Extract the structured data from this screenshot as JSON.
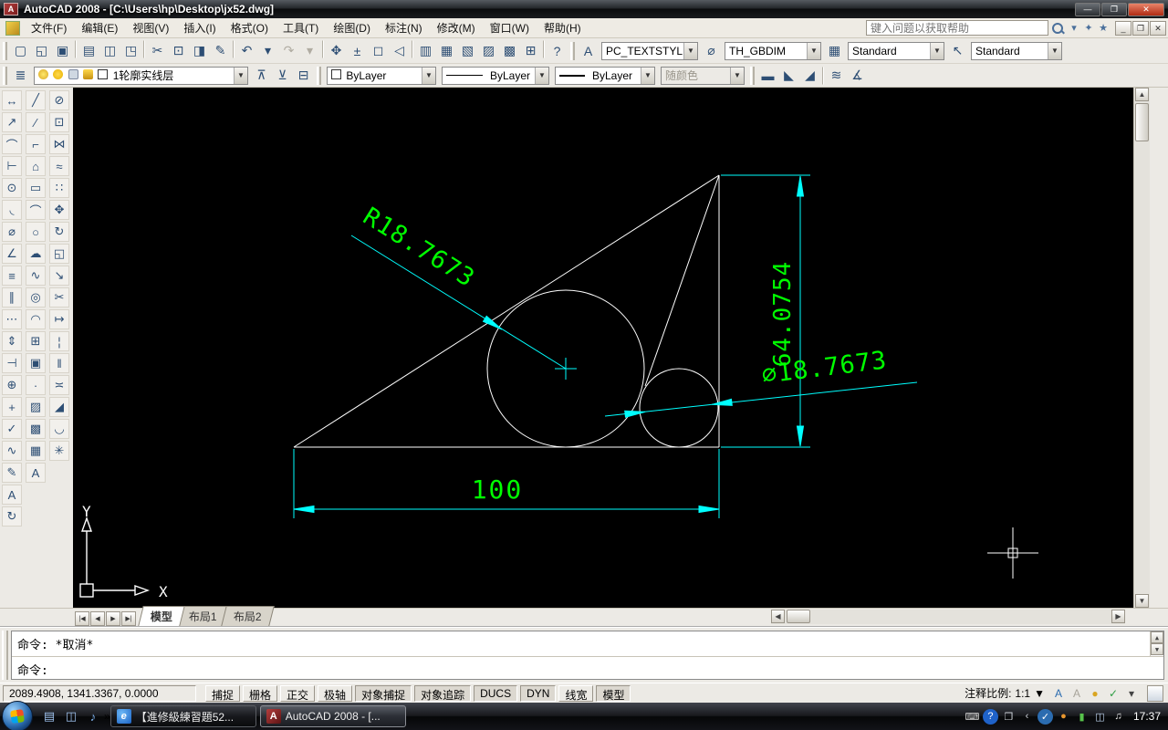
{
  "window": {
    "title": "AutoCAD 2008 - [C:\\Users\\hp\\Desktop\\jx52.dwg]",
    "controls": {
      "minimize": "—",
      "restore": "❐",
      "close": "✕"
    },
    "doc_controls": {
      "minimize": "_",
      "restore": "❐",
      "close": "✕"
    }
  },
  "menu": {
    "items": [
      "文件(F)",
      "编辑(E)",
      "视图(V)",
      "插入(I)",
      "格式(O)",
      "工具(T)",
      "绘图(D)",
      "标注(N)",
      "修改(M)",
      "窗口(W)",
      "帮助(H)"
    ],
    "help_placeholder": "键入问题以获取帮助"
  },
  "toolbars": {
    "standard": [
      {
        "name": "new-file",
        "glyph": "▢"
      },
      {
        "name": "open-file",
        "glyph": "◱"
      },
      {
        "name": "save-file",
        "glyph": "▣"
      },
      {
        "name": "separator",
        "sep": true
      },
      {
        "name": "plot",
        "glyph": "▤"
      },
      {
        "name": "plot-preview",
        "glyph": "◫"
      },
      {
        "name": "publish",
        "glyph": "◳"
      },
      {
        "name": "separator",
        "sep": true
      },
      {
        "name": "cut",
        "glyph": "✂"
      },
      {
        "name": "copy-clip",
        "glyph": "⊡"
      },
      {
        "name": "paste",
        "glyph": "◨"
      },
      {
        "name": "match-properties",
        "glyph": "✎"
      },
      {
        "name": "separator",
        "sep": true
      },
      {
        "name": "undo",
        "glyph": "↶"
      },
      {
        "name": "undo-dropdown",
        "glyph": "▾"
      },
      {
        "name": "redo",
        "glyph": "↷",
        "disabled": true
      },
      {
        "name": "redo-dropdown",
        "glyph": "▾",
        "disabled": true
      },
      {
        "name": "separator",
        "sep": true
      },
      {
        "name": "pan",
        "glyph": "✥"
      },
      {
        "name": "zoom-realtime",
        "glyph": "±"
      },
      {
        "name": "zoom-window",
        "glyph": "◻"
      },
      {
        "name": "zoom-previous",
        "glyph": "◁"
      },
      {
        "name": "separator",
        "sep": true
      },
      {
        "name": "properties-palette",
        "glyph": "▥"
      },
      {
        "name": "designcenter",
        "glyph": "▦"
      },
      {
        "name": "tool-palettes",
        "glyph": "▧"
      },
      {
        "name": "sheet-set-manager",
        "glyph": "▨"
      },
      {
        "name": "markup-set-manager",
        "glyph": "▩"
      },
      {
        "name": "quickcalc",
        "glyph": "⊞"
      },
      {
        "name": "separator",
        "sep": true
      },
      {
        "name": "help",
        "glyph": "?"
      }
    ],
    "styles": {
      "text_style_label": "PC_TEXTSTYLE",
      "dim_style_label": "TH_GBDIM",
      "table_style_label": "Standard",
      "mleader_style_label": "Standard"
    },
    "layers": {
      "layer_name": "1轮廓实线层",
      "color": "ByLayer",
      "linetype": "ByLayer",
      "lineweight": "ByLayer",
      "plot_style": "随颜色",
      "side_buttons": [
        {
          "name": "make-object-layer-current",
          "glyph": "⊼"
        },
        {
          "name": "layer-previous",
          "glyph": "⊻"
        },
        {
          "name": "layer-states-manager",
          "glyph": "⊟"
        }
      ]
    }
  },
  "left_toolbars": {
    "dimension": [
      {
        "name": "linear-dimension",
        "glyph": "↔"
      },
      {
        "name": "aligned-dimension",
        "glyph": "↗"
      },
      {
        "name": "arc-length-dimension",
        "glyph": "⌒"
      },
      {
        "name": "ordinate-dimension",
        "glyph": "⊢"
      },
      {
        "name": "radius-dimension",
        "glyph": "⊙"
      },
      {
        "name": "jogged-dimension",
        "glyph": "◟"
      },
      {
        "name": "diameter-dimension",
        "glyph": "⌀"
      },
      {
        "name": "angular-dimension",
        "glyph": "∠"
      },
      {
        "name": "quick-dimension",
        "glyph": "≡"
      },
      {
        "name": "baseline-dimension",
        "glyph": "∥"
      },
      {
        "name": "continue-dimension",
        "glyph": "⋯"
      },
      {
        "name": "dimension-space",
        "glyph": "⇕"
      },
      {
        "name": "dimension-break",
        "glyph": "⊣"
      },
      {
        "name": "tolerance",
        "glyph": "⊕"
      },
      {
        "name": "center-mark",
        "glyph": "+"
      },
      {
        "name": "inspection",
        "glyph": "✓"
      },
      {
        "name": "jogged-linear",
        "glyph": "∿"
      },
      {
        "name": "dimension-edit",
        "glyph": "✎"
      },
      {
        "name": "dimension-text-edit",
        "glyph": "A"
      },
      {
        "name": "dimension-update",
        "glyph": "↻"
      }
    ],
    "draw": [
      {
        "name": "line",
        "glyph": "╱"
      },
      {
        "name": "construction-line",
        "glyph": "∕"
      },
      {
        "name": "polyline",
        "glyph": "⌐"
      },
      {
        "name": "polygon",
        "glyph": "⌂"
      },
      {
        "name": "rectangle",
        "glyph": "▭"
      },
      {
        "name": "arc",
        "glyph": "⌒"
      },
      {
        "name": "circle",
        "glyph": "○"
      },
      {
        "name": "revision-cloud",
        "glyph": "☁"
      },
      {
        "name": "spline",
        "glyph": "∿"
      },
      {
        "name": "ellipse",
        "glyph": "◎"
      },
      {
        "name": "ellipse-arc",
        "glyph": "◠"
      },
      {
        "name": "insert-block",
        "glyph": "⊞"
      },
      {
        "name": "make-block",
        "glyph": "▣"
      },
      {
        "name": "point",
        "glyph": "·"
      },
      {
        "name": "hatch",
        "glyph": "▨"
      },
      {
        "name": "gradient",
        "glyph": "▩"
      },
      {
        "name": "table",
        "glyph": "▦"
      },
      {
        "name": "multiline-text",
        "glyph": "A"
      }
    ],
    "modify": [
      {
        "name": "erase",
        "glyph": "⊘"
      },
      {
        "name": "copy",
        "glyph": "⊡"
      },
      {
        "name": "mirror",
        "glyph": "⋈"
      },
      {
        "name": "offset",
        "glyph": "≈"
      },
      {
        "name": "array",
        "glyph": "∷"
      },
      {
        "name": "move",
        "glyph": "✥"
      },
      {
        "name": "rotate",
        "glyph": "↻"
      },
      {
        "name": "scale",
        "glyph": "◱"
      },
      {
        "name": "stretch",
        "glyph": "↘"
      },
      {
        "name": "trim",
        "glyph": "✂"
      },
      {
        "name": "extend",
        "glyph": "↦"
      },
      {
        "name": "break-at-point",
        "glyph": "¦"
      },
      {
        "name": "break",
        "glyph": "‖"
      },
      {
        "name": "join",
        "glyph": "≍"
      },
      {
        "name": "chamfer",
        "glyph": "◢"
      },
      {
        "name": "fillet",
        "glyph": "◡"
      },
      {
        "name": "explode",
        "glyph": "✳"
      }
    ]
  },
  "drawing": {
    "dim_radius": "R18.7673",
    "dim_vertical": "64.0754",
    "dim_diameter": "∅18.7673",
    "dim_horizontal": "100",
    "ucs_x": "X",
    "ucs_y": "Y",
    "geometry_color": "#ffffff",
    "dim_line_color": "#00ffff",
    "dim_text_color": "#00ff00"
  },
  "tabs": {
    "nav": [
      {
        "name": "first-tab",
        "glyph": "|◀"
      },
      {
        "name": "prev-tab",
        "glyph": "◀"
      },
      {
        "name": "next-tab",
        "glyph": "▶"
      },
      {
        "name": "last-tab",
        "glyph": "▶|"
      }
    ],
    "items": [
      {
        "name": "model",
        "label": "模型",
        "active": true
      },
      {
        "name": "layout1",
        "label": "布局1"
      },
      {
        "name": "layout2",
        "label": "布局2"
      }
    ]
  },
  "command": {
    "history": "命令: *取消*",
    "prompt": "命令:"
  },
  "statusbar": {
    "coords": "2089.4908, 1341.3367, 0.0000",
    "toggles": [
      {
        "name": "snap",
        "label": "捕捉"
      },
      {
        "name": "grid",
        "label": "栅格"
      },
      {
        "name": "ortho",
        "label": "正交"
      },
      {
        "name": "polar",
        "label": "极轴"
      },
      {
        "name": "osnap",
        "label": "对象捕捉",
        "pressed": true
      },
      {
        "name": "otrack",
        "label": "对象追踪",
        "pressed": true
      },
      {
        "name": "ducs",
        "label": "DUCS",
        "pressed": true
      },
      {
        "name": "dyn",
        "label": "DYN",
        "pressed": true
      },
      {
        "name": "lineweight",
        "label": "线宽"
      },
      {
        "name": "model-space",
        "label": "模型",
        "pressed": true
      }
    ],
    "annotation_scale_label": "注释比例:",
    "annotation_scale_value": "1:1",
    "right_icons": [
      {
        "name": "annotation-visibility-icon",
        "glyph": "A",
        "color": "#2b6cb0"
      },
      {
        "name": "annotation-autoscale-icon",
        "glyph": "A",
        "color": "#a8a49a"
      },
      {
        "name": "toolbar-lock-icon",
        "glyph": "●",
        "color": "#d9a521"
      },
      {
        "name": "status-tray-icon",
        "glyph": "✓",
        "color": "#2f9e44"
      },
      {
        "name": "status-dropdown-icon",
        "glyph": "▾",
        "color": "#444444"
      }
    ]
  },
  "taskbar": {
    "quick_launch": [
      {
        "name": "show-desktop-icon",
        "glyph": "▤",
        "color": "#9fc3ef"
      },
      {
        "name": "window-switcher-icon",
        "glyph": "◫",
        "color": "#9fc3ef"
      },
      {
        "name": "media-player-icon",
        "glyph": "♪",
        "color": "#7fb3f0"
      }
    ],
    "more_chevron": "»",
    "tasks": [
      {
        "name": "task-ie",
        "icon": "ie",
        "icon_glyph": "e",
        "label": "【進修級練習題52..."
      },
      {
        "name": "task-autocad",
        "icon": "acad",
        "icon_glyph": "A",
        "label": "AutoCAD 2008 - [...",
        "active": true
      }
    ],
    "tray": [
      {
        "name": "keyboard-icon",
        "glyph": "⌨",
        "color": "#d8d8d8"
      },
      {
        "name": "help-tray-icon",
        "glyph": "?",
        "color": "#ffffff",
        "bg": "#1f62c9",
        "round": true
      },
      {
        "name": "restore-tray-icon",
        "glyph": "❐",
        "color": "#cfd4da"
      },
      {
        "name": "chevron-left-icon",
        "glyph": "‹",
        "color": "#cfd4da"
      },
      {
        "name": "security-shield-icon",
        "glyph": "✓",
        "color": "#ffffff",
        "bg": "#2b6cb0",
        "round": true
      },
      {
        "name": "paint-tray-icon",
        "glyph": "●",
        "color": "#e8962e"
      },
      {
        "name": "power-plug-icon",
        "glyph": "▮",
        "color": "#57c24b"
      },
      {
        "name": "network-icon",
        "glyph": "◫",
        "color": "#bcd2ec"
      },
      {
        "name": "volume-icon",
        "glyph": "♫",
        "color": "#e8e8e8"
      }
    ],
    "clock": "17:37"
  }
}
